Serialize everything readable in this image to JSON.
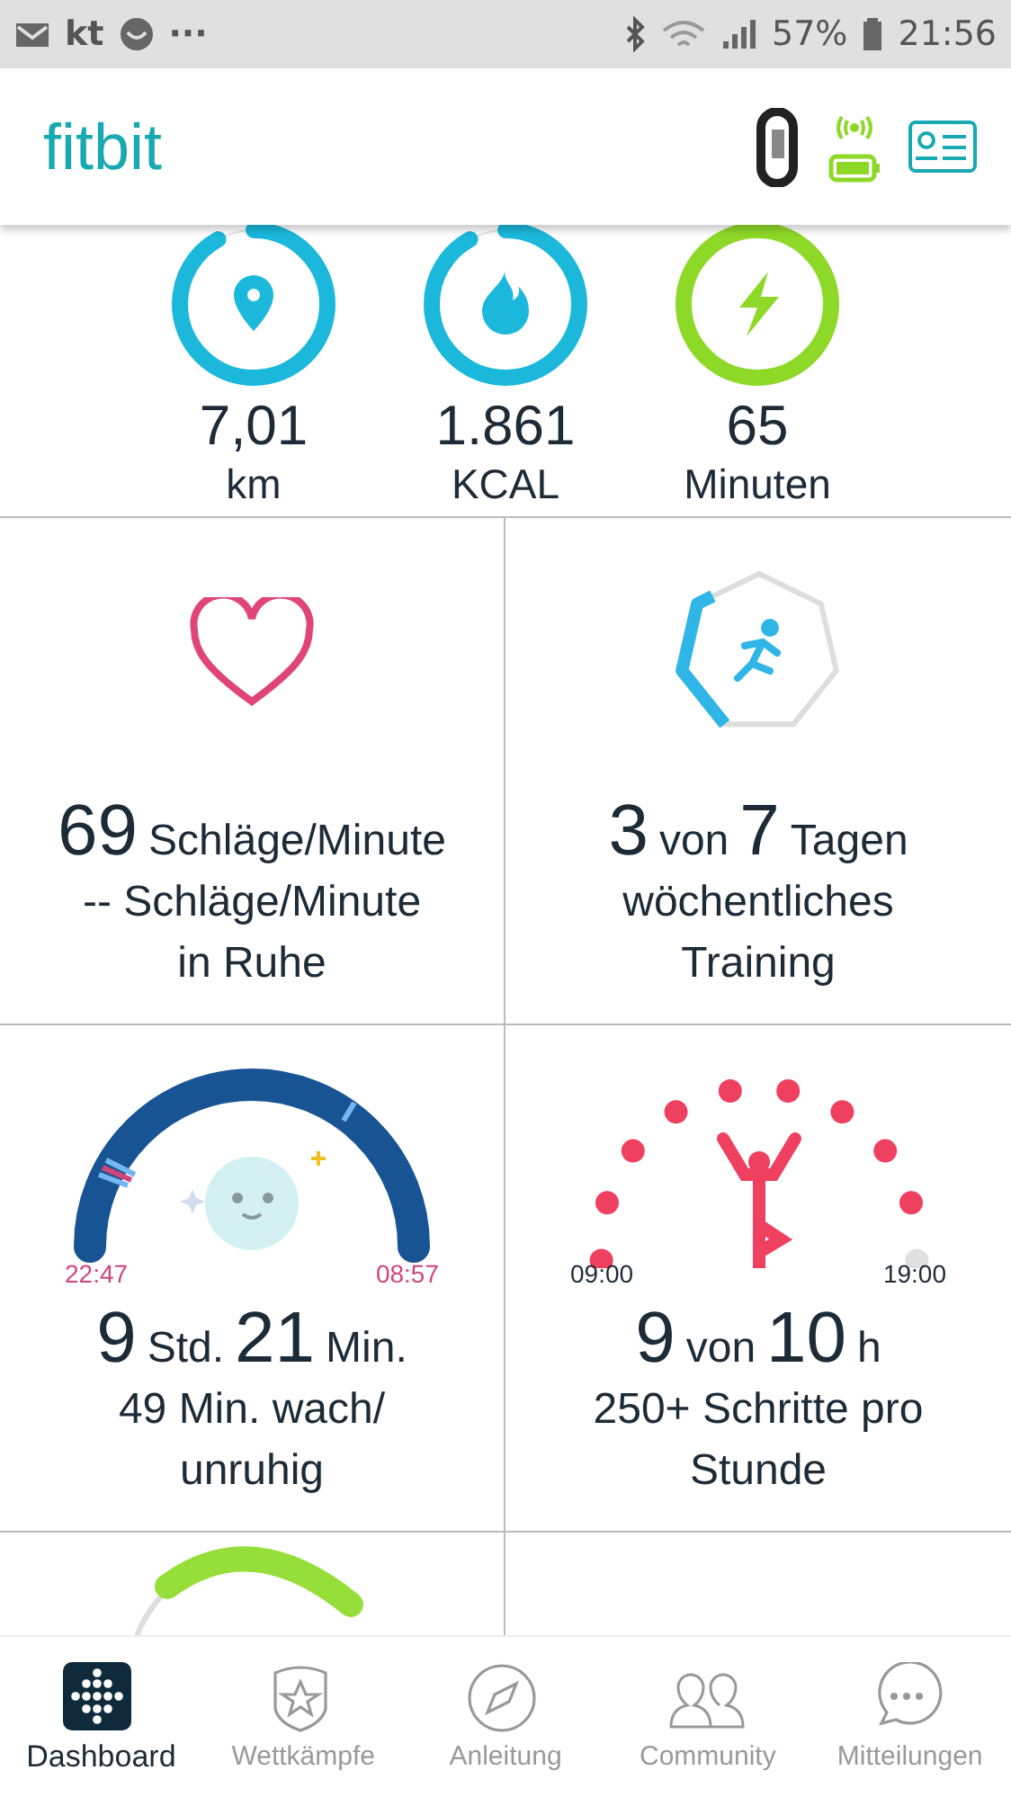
{
  "status_bar": {
    "app_label": "kt",
    "more": "···",
    "battery": "57%",
    "time": "21:56"
  },
  "header": {
    "logo": "fitbit"
  },
  "rings": [
    {
      "value": "7,01",
      "unit": "km"
    },
    {
      "value": "1.861",
      "unit": "KCAL"
    },
    {
      "value": "65",
      "unit": "Minuten"
    }
  ],
  "tiles": [
    {
      "kind": "heart",
      "headline": [
        {
          "text": "69",
          "big": true
        },
        {
          "text": "Schläge/Minute",
          "big": false
        }
      ],
      "lines": [
        "-- Schläge/Minute",
        "in Ruhe"
      ]
    },
    {
      "kind": "exercise",
      "headline": [
        {
          "text": "3",
          "big": true
        },
        {
          "text": "von",
          "big": false
        },
        {
          "text": "7",
          "big": true
        },
        {
          "text": "Tagen",
          "big": false
        }
      ],
      "lines": [
        "wöchentliches",
        "Training"
      ]
    },
    {
      "kind": "sleep",
      "start": "22:47",
      "end": "08:57",
      "headline": [
        {
          "text": "9",
          "big": true
        },
        {
          "text": "Std.",
          "big": false
        },
        {
          "text": "21",
          "big": true
        },
        {
          "text": "Min.",
          "big": false
        }
      ],
      "lines": [
        "49 Min. wach/",
        "unruhig"
      ]
    },
    {
      "kind": "hourly",
      "start": "09:00",
      "end": "19:00",
      "hours": [
        {
          "on": true
        },
        {
          "on": true
        },
        {
          "on": true
        },
        {
          "on": true
        },
        {
          "on": true
        },
        {
          "on": true
        },
        {
          "on": true
        },
        {
          "on": true
        },
        {
          "on": true
        },
        {
          "on": false
        }
      ],
      "headline": [
        {
          "text": "9",
          "big": true
        },
        {
          "text": "von",
          "big": false
        },
        {
          "text": "10",
          "big": true
        },
        {
          "text": "h",
          "big": false
        }
      ],
      "lines": [
        "250+ Schritte pro",
        "Stunde"
      ]
    },
    {
      "kind": "partial_ring"
    },
    {
      "kind": "empty"
    }
  ],
  "nav": [
    {
      "label": "Dashboard",
      "selected": true
    },
    {
      "label": "Wettkämpfe",
      "selected": false
    },
    {
      "label": "Anleitung",
      "selected": false
    },
    {
      "label": "Community",
      "selected": false
    },
    {
      "label": "Mitteilungen",
      "selected": false
    }
  ]
}
